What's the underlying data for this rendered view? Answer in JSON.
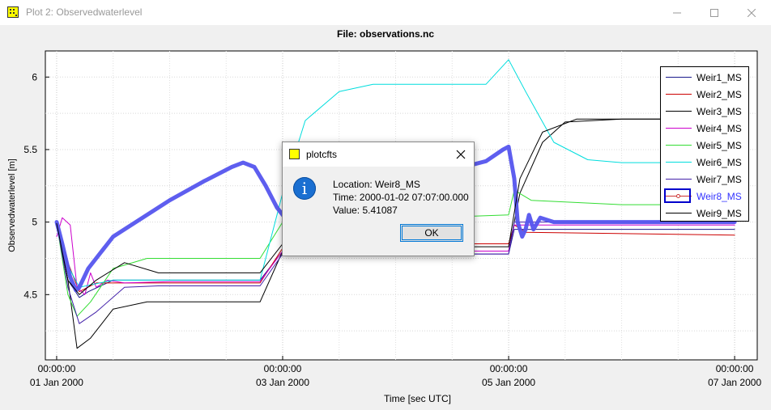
{
  "window": {
    "title": "Plot 2: Observedwaterlevel",
    "file_title": "File: observations.nc"
  },
  "chart_data": {
    "type": "line",
    "xlabel": "Time [sec UTC]",
    "ylabel": "Observedwaterlevel [m]",
    "x_ticks": [
      {
        "time": "00:00:00",
        "date": "01 Jan 2000",
        "day": 0
      },
      {
        "time": "00:00:00",
        "date": "03 Jan 2000",
        "day": 2
      },
      {
        "time": "00:00:00",
        "date": "05 Jan 2000",
        "day": 4
      },
      {
        "time": "00:00:00",
        "date": "07 Jan 2000",
        "day": 6
      }
    ],
    "y_ticks": [
      "4.5",
      "5",
      "5.5",
      "6"
    ],
    "xlim_days": [
      -0.1,
      6.2
    ],
    "ylim": [
      4.05,
      6.18
    ],
    "grid": true,
    "legend_position": "top-right",
    "series": [
      {
        "name": "Weir1_MS",
        "color": "#1a1a8c",
        "width": 1,
        "points": [
          [
            0,
            4.99
          ],
          [
            0.1,
            4.6
          ],
          [
            0.2,
            4.48
          ],
          [
            0.28,
            4.52
          ],
          [
            0.5,
            4.6
          ],
          [
            1,
            4.6
          ],
          [
            1.8,
            4.6
          ],
          [
            2,
            4.8
          ],
          [
            2.5,
            4.78
          ],
          [
            4,
            4.78
          ],
          [
            4.05,
            4.95
          ],
          [
            5,
            4.95
          ],
          [
            6,
            4.95
          ]
        ]
      },
      {
        "name": "Weir2_MS",
        "color": "#cc0000",
        "width": 1,
        "points": [
          [
            0,
            4.97
          ],
          [
            0.1,
            4.72
          ],
          [
            0.2,
            4.52
          ],
          [
            0.35,
            4.58
          ],
          [
            1,
            4.58
          ],
          [
            1.8,
            4.58
          ],
          [
            2,
            4.82
          ],
          [
            2.5,
            4.85
          ],
          [
            4,
            4.85
          ],
          [
            4.05,
            4.98
          ],
          [
            4.15,
            4.93
          ],
          [
            6,
            4.91
          ]
        ]
      },
      {
        "name": "Weir3_MS",
        "color": "#000000",
        "width": 1,
        "points": [
          [
            0,
            4.98
          ],
          [
            0.1,
            4.6
          ],
          [
            0.18,
            4.13
          ],
          [
            0.3,
            4.2
          ],
          [
            0.5,
            4.4
          ],
          [
            0.8,
            4.45
          ],
          [
            1.8,
            4.45
          ],
          [
            2,
            4.8
          ],
          [
            2.5,
            4.8
          ],
          [
            4,
            4.8
          ],
          [
            4.1,
            5.2
          ],
          [
            4.3,
            5.55
          ],
          [
            4.5,
            5.69
          ],
          [
            5,
            5.71
          ],
          [
            6,
            5.71
          ]
        ]
      },
      {
        "name": "Weir4_MS",
        "color": "#cc00cc",
        "width": 1,
        "points": [
          [
            0,
            4.9
          ],
          [
            0.05,
            5.03
          ],
          [
            0.12,
            4.98
          ],
          [
            0.18,
            4.55
          ],
          [
            0.25,
            4.5
          ],
          [
            0.3,
            4.65
          ],
          [
            0.35,
            4.55
          ],
          [
            0.45,
            4.6
          ],
          [
            0.6,
            4.58
          ],
          [
            1,
            4.59
          ],
          [
            1.8,
            4.59
          ],
          [
            2,
            4.8
          ],
          [
            2.5,
            4.8
          ],
          [
            4,
            4.8
          ],
          [
            4.05,
            4.98
          ],
          [
            5,
            4.98
          ],
          [
            6,
            4.98
          ]
        ]
      },
      {
        "name": "Weir5_MS",
        "color": "#33dd33",
        "width": 1,
        "points": [
          [
            0,
            4.99
          ],
          [
            0.1,
            4.5
          ],
          [
            0.18,
            4.35
          ],
          [
            0.3,
            4.45
          ],
          [
            0.5,
            4.68
          ],
          [
            0.8,
            4.75
          ],
          [
            1.8,
            4.75
          ],
          [
            2,
            5.0
          ],
          [
            2.2,
            5.0
          ],
          [
            4,
            5.05
          ],
          [
            4.05,
            5.22
          ],
          [
            4.2,
            5.15
          ],
          [
            5,
            5.12
          ],
          [
            6,
            5.12
          ]
        ]
      },
      {
        "name": "Weir6_MS",
        "color": "#00dddd",
        "width": 1,
        "points": [
          [
            0,
            4.99
          ],
          [
            0.1,
            4.7
          ],
          [
            0.2,
            4.55
          ],
          [
            0.5,
            4.6
          ],
          [
            1,
            4.6
          ],
          [
            1.8,
            4.6
          ],
          [
            2,
            5.2
          ],
          [
            2.2,
            5.7
          ],
          [
            2.5,
            5.9
          ],
          [
            2.8,
            5.95
          ],
          [
            3.8,
            5.95
          ],
          [
            4,
            6.12
          ],
          [
            4.15,
            5.9
          ],
          [
            4.4,
            5.55
          ],
          [
            4.7,
            5.43
          ],
          [
            5,
            5.41
          ],
          [
            6,
            5.41
          ]
        ]
      },
      {
        "name": "Weir7_MS",
        "color": "#4422aa",
        "width": 1,
        "points": [
          [
            0,
            4.99
          ],
          [
            0.1,
            4.55
          ],
          [
            0.2,
            4.3
          ],
          [
            0.35,
            4.38
          ],
          [
            0.6,
            4.55
          ],
          [
            0.9,
            4.56
          ],
          [
            1.8,
            4.56
          ],
          [
            2,
            4.78
          ],
          [
            2.5,
            4.78
          ],
          [
            4,
            4.78
          ],
          [
            4.05,
            5.0
          ],
          [
            5,
            5.0
          ],
          [
            6,
            5.0
          ]
        ]
      },
      {
        "name": "Weir8_MS",
        "color": "#5555ee",
        "width": 5,
        "points": [
          [
            0,
            5.0
          ],
          [
            0.05,
            4.85
          ],
          [
            0.12,
            4.62
          ],
          [
            0.17,
            4.53
          ],
          [
            0.2,
            4.55
          ],
          [
            0.28,
            4.68
          ],
          [
            0.5,
            4.9
          ],
          [
            1,
            5.15
          ],
          [
            1.3,
            5.28
          ],
          [
            1.55,
            5.38
          ],
          [
            1.65,
            5.41
          ],
          [
            1.75,
            5.38
          ],
          [
            1.85,
            5.25
          ],
          [
            1.95,
            5.1
          ],
          [
            2.05,
            5.0
          ],
          [
            2.15,
            4.98
          ],
          [
            2.25,
            5.02
          ],
          [
            2.35,
            5.15
          ],
          [
            2.5,
            5.3
          ],
          [
            2.8,
            5.34
          ],
          [
            3.2,
            5.35
          ],
          [
            3.6,
            5.38
          ],
          [
            3.8,
            5.42
          ],
          [
            3.95,
            5.5
          ],
          [
            4.0,
            5.52
          ],
          [
            4.05,
            5.3
          ],
          [
            4.08,
            5.0
          ],
          [
            4.12,
            4.9
          ],
          [
            4.15,
            4.95
          ],
          [
            4.18,
            5.05
          ],
          [
            4.22,
            4.95
          ],
          [
            4.28,
            5.03
          ],
          [
            4.4,
            5.0
          ],
          [
            5,
            5.0
          ],
          [
            6,
            5.0
          ]
        ]
      },
      {
        "name": "Weir9_MS",
        "color": "#000000",
        "width": 1,
        "points": [
          [
            0,
            4.99
          ],
          [
            0.1,
            4.6
          ],
          [
            0.2,
            4.5
          ],
          [
            0.35,
            4.6
          ],
          [
            0.6,
            4.72
          ],
          [
            0.9,
            4.65
          ],
          [
            1.8,
            4.65
          ],
          [
            2,
            4.85
          ],
          [
            2.5,
            4.83
          ],
          [
            4,
            4.83
          ],
          [
            4.1,
            5.3
          ],
          [
            4.3,
            5.62
          ],
          [
            4.6,
            5.71
          ],
          [
            5,
            5.71
          ],
          [
            6,
            5.71
          ]
        ]
      }
    ]
  },
  "legend": {
    "items": [
      {
        "label": "Weir1_MS",
        "color": "#1a1a8c"
      },
      {
        "label": "Weir2_MS",
        "color": "#cc0000"
      },
      {
        "label": "Weir3_MS",
        "color": "#000000"
      },
      {
        "label": "Weir4_MS",
        "color": "#cc00cc"
      },
      {
        "label": "Weir5_MS",
        "color": "#33dd33"
      },
      {
        "label": "Weir6_MS",
        "color": "#00dddd"
      },
      {
        "label": "Weir7_MS",
        "color": "#4422aa"
      },
      {
        "label": "Weir8_MS",
        "color": "#cc3333"
      },
      {
        "label": "Weir9_MS",
        "color": "#000000"
      }
    ],
    "selected": "Weir8_MS"
  },
  "dialog": {
    "title": "plotcfts",
    "location": "Location: Weir8_MS",
    "time": "Time: 2000-01-02 07:07:00.000",
    "value": "Value: 5.41087",
    "ok_label": "OK"
  }
}
